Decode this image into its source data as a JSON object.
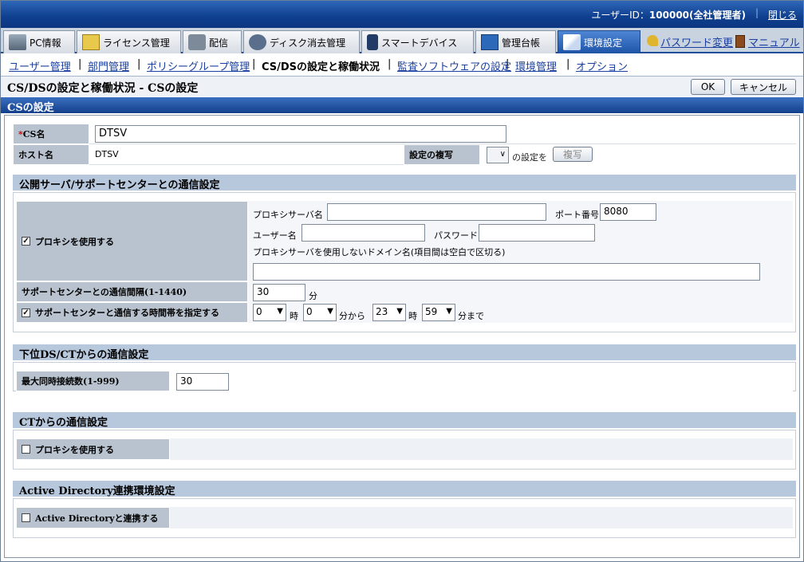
{
  "header": {
    "user_id_label": "ユーザーID：",
    "user_id_value": "100000(全社管理者)",
    "logout": "閉じる"
  },
  "tabs": [
    {
      "label": "PC情報",
      "icon": "pc-icon"
    },
    {
      "label": "ライセンス管理",
      "icon": "license-icon"
    },
    {
      "label": "配信",
      "icon": "distribution-icon"
    },
    {
      "label": "ディスク消去管理",
      "icon": "disk-icon"
    },
    {
      "label": "スマートデバイス",
      "icon": "smartphone-icon"
    },
    {
      "label": "管理台帳",
      "icon": "ledger-icon"
    },
    {
      "label": "環境設定",
      "icon": "tools-icon",
      "active": true
    }
  ],
  "ext_links": {
    "password": "パスワード変更",
    "manual": "マニュアル"
  },
  "subnav": {
    "items": [
      "ユーザー管理",
      "部門管理",
      "ポリシーグループ管理",
      "CS/DSの設定と稼働状況",
      "監査ソフトウェアの設定",
      "環境管理",
      "オプション"
    ],
    "current": "CS/DSの設定と稼働状況"
  },
  "page": {
    "title": "CS/DSの設定と稼働状況 - CSの設定",
    "ok": "OK",
    "cancel": "キャンセル",
    "section": "CSの設定"
  },
  "cs": {
    "name_label_star": "*",
    "name_label": "CS名",
    "name_value": "DTSV",
    "host_label": "ホスト名",
    "host_value": "DTSV",
    "copy_label": "設定の複写",
    "copy_suffix": "の設定を",
    "copy_button": "複写"
  },
  "public": {
    "title": "公開サーバ/サポートセンターとの通信設定",
    "use_proxy": "プロキシを使用する",
    "proxy_checked": true,
    "proxy_server_label": "プロキシサーバ名",
    "proxy_server_value": "",
    "port_label": "ポート番号",
    "port_value": "8080",
    "user_label": "ユーザー名",
    "user_value": "",
    "password_label": "パスワード",
    "password_value": "",
    "no_proxy_label": "プロキシサーバを使用しないドメイン名(項目間は空白で区切る)",
    "no_proxy_value": "",
    "interval_label": "サポートセンターとの通信間隔(1-1440)",
    "interval_value": "30",
    "interval_unit": "分",
    "timeband_label": "サポートセンターと通信する時間帯を指定する",
    "timeband_checked": true,
    "from_hour": "0",
    "hour_unit1": "時",
    "from_min": "0",
    "from_unit": "分から",
    "to_hour": "23",
    "hour_unit2": "時",
    "to_min": "59",
    "to_unit": "分まで"
  },
  "lower": {
    "title": "下位DS/CTからの通信設定",
    "max_label": "最大同時接続数(1-999)",
    "max_value": "30"
  },
  "ct": {
    "title": "CTからの通信設定",
    "use_proxy": "プロキシを使用する",
    "checked": false
  },
  "ad": {
    "title": "Active Directory連携環境設定",
    "link_label": "Active Directoryと連携する",
    "checked": false
  }
}
